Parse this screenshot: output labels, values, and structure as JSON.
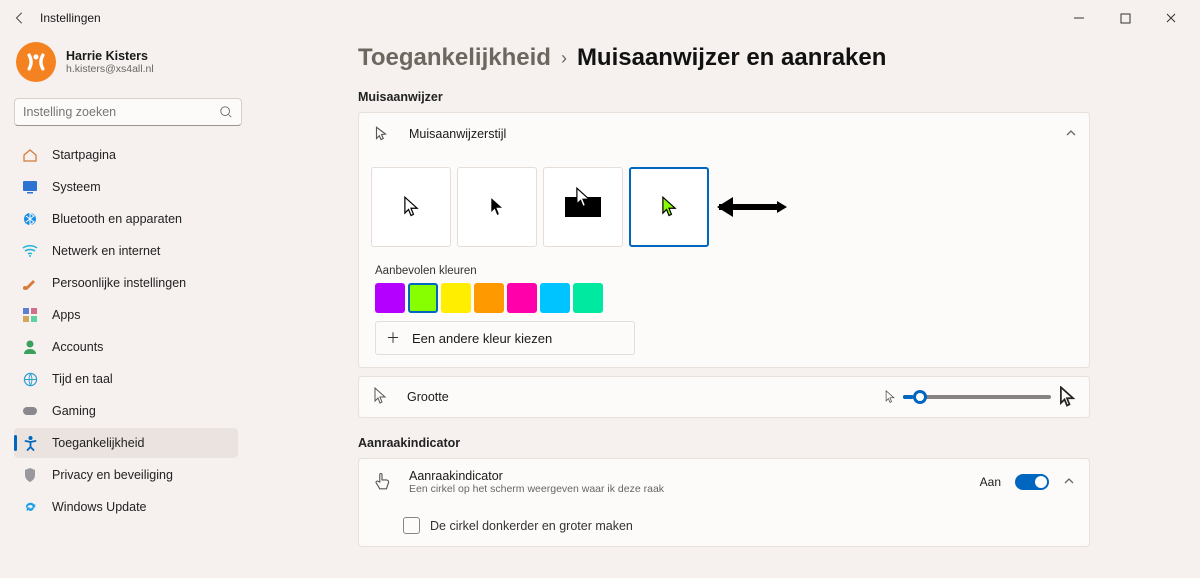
{
  "window": {
    "title": "Instellingen"
  },
  "user": {
    "name": "Harrie Kisters",
    "email": "h.kisters@xs4all.nl"
  },
  "search": {
    "placeholder": "Instelling zoeken"
  },
  "nav": {
    "home": "Startpagina",
    "system": "Systeem",
    "bluetooth": "Bluetooth en apparaten",
    "network": "Netwerk en internet",
    "personal": "Persoonlijke instellingen",
    "apps": "Apps",
    "accounts": "Accounts",
    "time": "Tijd en taal",
    "gaming": "Gaming",
    "accessibility": "Toegankelijkheid",
    "privacy": "Privacy en beveiliging",
    "update": "Windows Update"
  },
  "breadcrumb": {
    "parent": "Toegankelijkheid",
    "current": "Muisaanwijzer en aanraken"
  },
  "pointer": {
    "section": "Muisaanwijzer",
    "styleLabel": "Muisaanwijzerstijl",
    "colorsLabel": "Aanbevolen kleuren",
    "swatches": [
      "#b400ff",
      "#88ff00",
      "#ffee00",
      "#ff9900",
      "#ff00aa",
      "#00c4ff",
      "#00e9a0"
    ],
    "anotherColor": "Een andere kleur kiezen",
    "sizeLabel": "Grootte"
  },
  "touch": {
    "section": "Aanraakindicator",
    "head": "Aanraakindicator",
    "sub": "Een cirkel op het scherm weergeven waar ik deze raak",
    "state": "Aan",
    "darker": "De cirkel donkerder en groter maken"
  }
}
